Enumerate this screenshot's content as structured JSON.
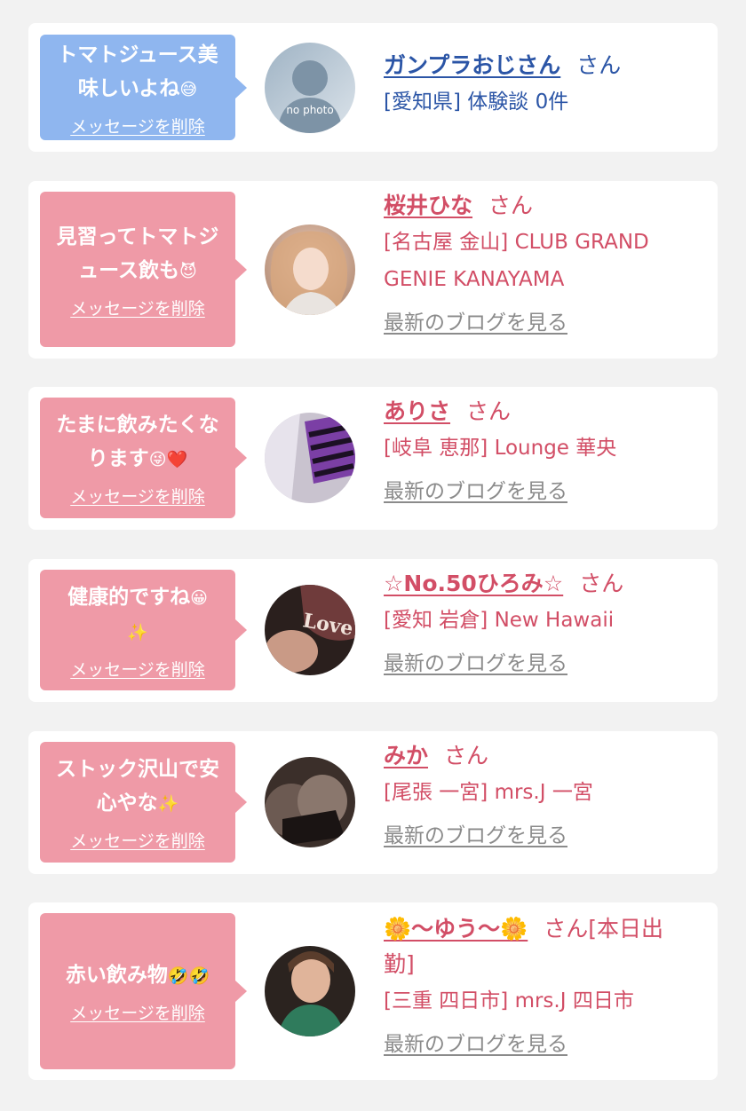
{
  "colors": {
    "background": "#f2f2f2",
    "card": "#ffffff",
    "bubble_blue": "#8fb6ef",
    "bubble_pink": "#ef9aa7",
    "name_blue": "#2b55a6",
    "name_red": "#d24e66",
    "blog_link_gray": "#8b8b8b"
  },
  "messages": [
    {
      "bubble_color": "blue",
      "message_lines": [
        "トマトジュース美",
        "味しいよね"
      ],
      "message_emoji": "😅",
      "delete_label": "メッセージを削除",
      "avatar_icon": "no-photo-icon",
      "avatar_text": "no photo",
      "name": "ガンプラおじさん",
      "suffix": "さん",
      "detail": "[愛知県] 体験談 0件",
      "blog_label": ""
    },
    {
      "bubble_color": "pink",
      "message_lines": [
        "見習ってトマトジ",
        "ュース飲も"
      ],
      "message_emoji": "😈",
      "delete_label": "メッセージを削除",
      "avatar_icon": "profile-photo",
      "name": "桜井ひな",
      "suffix": "さん",
      "detail_lines": [
        "[名古屋 金山] CLUB GRAND",
        "GENIE KANAYAMA"
      ],
      "blog_label": "最新のブログを見る"
    },
    {
      "bubble_color": "pink",
      "message_lines": [
        "たまに飲みたくな",
        "ります"
      ],
      "message_emoji": "😜❤️",
      "delete_label": "メッセージを削除",
      "avatar_icon": "profile-photo",
      "name": "ありさ",
      "suffix": "さん",
      "detail": "[岐阜 恵那] Lounge 華央",
      "blog_label": "最新のブログを見る"
    },
    {
      "bubble_color": "pink",
      "message_lines": [
        "健康的ですね"
      ],
      "message_emoji": "😀",
      "message_extra": "✨",
      "delete_label": "メッセージを削除",
      "avatar_icon": "profile-photo",
      "name": "☆No.50ひろみ☆",
      "suffix": "さん",
      "detail": "[愛知 岩倉] New Hawaii",
      "blog_label": "最新のブログを見る"
    },
    {
      "bubble_color": "pink",
      "message_lines": [
        "ストック沢山で安",
        "心やな"
      ],
      "message_emoji": "✨",
      "delete_label": "メッセージを削除",
      "avatar_icon": "profile-photo",
      "name": "みか",
      "suffix": "さん",
      "detail": "[尾張 一宮] mrs.J 一宮",
      "blog_label": "最新のブログを見る"
    },
    {
      "bubble_color": "pink",
      "message_lines": [
        "赤い飲み物"
      ],
      "message_emoji": "🤣🤣",
      "delete_label": "メッセージを削除",
      "avatar_icon": "profile-photo",
      "name": "🌼〜ゆう〜🌼",
      "suffix": "さん[本日出",
      "suffix_line2": "勤]",
      "detail": "[三重 四日市] mrs.J 四日市",
      "blog_label": "最新のブログを見る"
    }
  ]
}
